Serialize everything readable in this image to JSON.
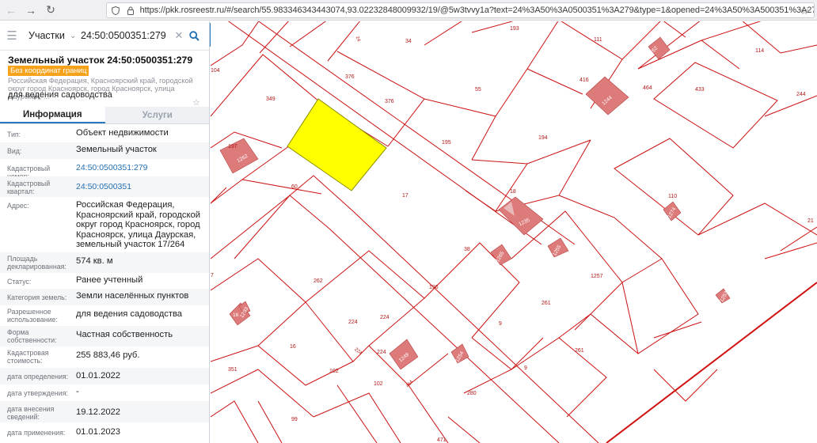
{
  "browser": {
    "back_icon": "arrow-left-icon",
    "forward_icon": "arrow-right-icon",
    "reload_icon": "reload-icon",
    "url": "https://pkk.rosreestr.ru/#/search/55.983346343443074,93.02232848009932/19/@5w3tvvy1a?text=24%3A50%3A0500351%3A279&type=1&opened=24%3A50%3A500351%3A279"
  },
  "search": {
    "type_label": "Участки",
    "query": "24:50:0500351:279"
  },
  "parcel": {
    "title": "Земельный участок 24:50:0500351:279",
    "badge": "Без координат границ",
    "address_short": "Российская Федерация, Красноярский край, городской округ город Красноярск, город Красноярск, улица Даурская, ...",
    "purpose": "для ведения садоводства"
  },
  "tabs": {
    "info": "Информация",
    "services": "Услуги"
  },
  "fields": [
    {
      "label": "Тип:",
      "value": "Объект недвижимости"
    },
    {
      "label": "Вид:",
      "value": "Земельный участок"
    },
    {
      "label": "Кадастровый номер:",
      "value": "24:50:0500351:279"
    },
    {
      "label": "Кадастровый квартал:",
      "value": "24:50:0500351"
    },
    {
      "label": "Адрес:",
      "value": "Российская Федерация, Красноярский край, городской округ город Красноярск, город Красноярск, улица Даурская, земельный участок 17/264"
    },
    {
      "label": "Площадь декларированная:",
      "value": "574 кв. м"
    },
    {
      "label": "Статус:",
      "value": "Ранее учтенный"
    },
    {
      "label": "Категория земель:",
      "value": "Земли населённых пунктов"
    },
    {
      "label": "Разрешенное использование:",
      "value": "для ведения садоводства"
    },
    {
      "label": "Форма собственности:",
      "value": "Частная собственность"
    },
    {
      "label": "Кадастровая стоимость:",
      "value": "255 883,46 руб."
    },
    {
      "label": "дата определения:",
      "value": "01.01.2022"
    },
    {
      "label": "дата утверждения:",
      "value": "-"
    },
    {
      "label": "дата внесения сведений:",
      "value": "19.12.2022"
    },
    {
      "label": "дата применения:",
      "value": "01.01.2023"
    }
  ],
  "map": {
    "parcel_labels": [
      "104",
      "34",
      "193",
      "111",
      "114",
      "376",
      "55",
      "416",
      "433",
      "244",
      "349",
      "376",
      "195",
      "194",
      "464",
      "197",
      "60",
      "17",
      "18",
      "110",
      "38",
      "1257",
      "262",
      "196",
      "261",
      "9",
      "224",
      "224",
      "16",
      "224",
      "261",
      "351",
      "102",
      "102",
      "9",
      "280",
      "99",
      "471",
      "7",
      "21"
    ],
    "building_labels": [
      "262",
      "1244",
      "1262",
      "1274",
      "1235",
      "1265",
      "1255",
      "1253",
      "1233",
      "16",
      "1254",
      "1249"
    ],
    "colors": {
      "selected_fill": "#ffff00",
      "parcel_line": "#d01010",
      "building_fill": "#dd7a7a",
      "label": "#b01818"
    }
  }
}
